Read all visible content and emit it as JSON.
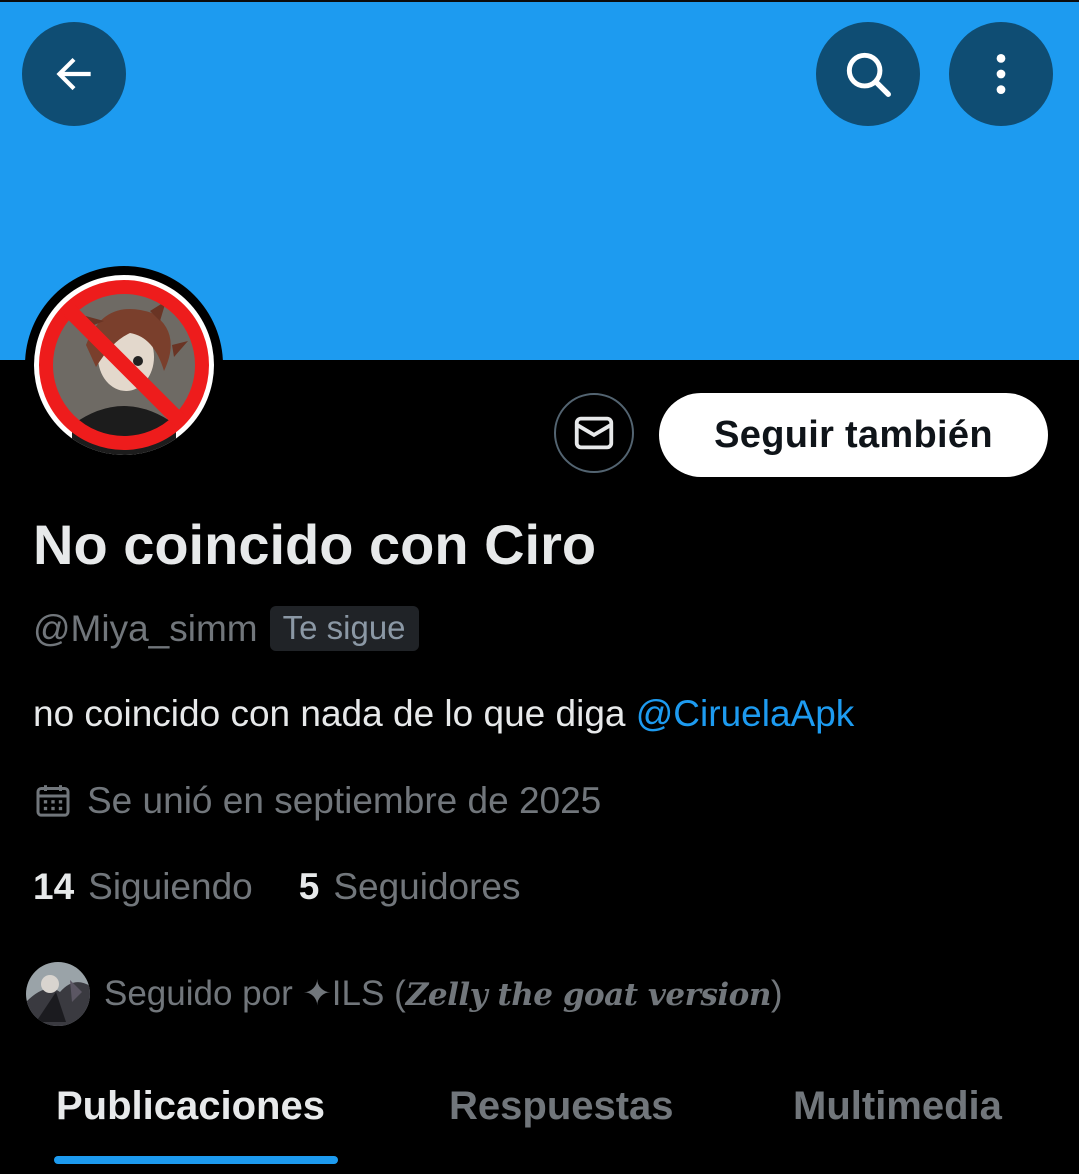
{
  "header": {
    "back_icon": "arrow-left-icon",
    "search_icon": "search-icon",
    "more_icon": "more-vertical-icon",
    "banner_color": "#1d9bf0"
  },
  "profile": {
    "display_name": "No coincido con Ciro",
    "handle": "@Miya_simm",
    "follows_you_badge": "Te sigue",
    "bio_text": "no coincido con nada de lo que diga ",
    "bio_mention": "@CiruelaApk",
    "joined": "Se unió en septiembre de 2025",
    "joined_icon": "calendar-icon"
  },
  "actions": {
    "message_icon": "envelope-icon",
    "follow_back_label": "Seguir también"
  },
  "stats": {
    "following_count": "14",
    "following_label": "Siguiendo",
    "followers_count": "5",
    "followers_label": "Seguidores"
  },
  "followed_by": {
    "prefix": "Seguido por ",
    "name_plain": "✦ILS (",
    "name_gothic": "Zelly the goat version",
    "suffix": ")"
  },
  "tabs": [
    {
      "label": "Publicaciones",
      "active": true
    },
    {
      "label": "Respuestas",
      "active": false
    },
    {
      "label": "Multimedia",
      "active": false
    }
  ],
  "colors": {
    "accent": "#1d9bf0",
    "muted": "#71767b",
    "text": "#e7e9ea",
    "background": "#000000"
  }
}
